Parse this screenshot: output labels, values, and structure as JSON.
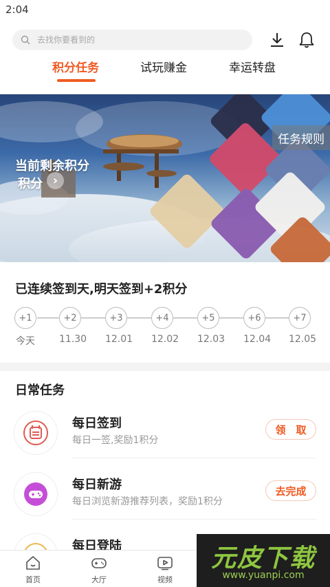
{
  "status_bar": {
    "time": "2:04"
  },
  "search": {
    "placeholder": "去找你要看到的"
  },
  "tabs": [
    {
      "label": "积分任务",
      "active": true
    },
    {
      "label": "试玩赚金",
      "active": false
    },
    {
      "label": "幸运转盘",
      "active": false
    }
  ],
  "banner": {
    "points_title": "当前剩余积分",
    "points_value": "积分",
    "rules_button": "任务规则"
  },
  "signin": {
    "title": "已连续签到天,明天签到+2积分",
    "steps": [
      {
        "reward": "+1",
        "date": "今天"
      },
      {
        "reward": "+2",
        "date": "11.30"
      },
      {
        "reward": "+3",
        "date": "12.01"
      },
      {
        "reward": "+4",
        "date": "12.02"
      },
      {
        "reward": "+5",
        "date": "12.03"
      },
      {
        "reward": "+6",
        "date": "12.04"
      },
      {
        "reward": "+7",
        "date": "12.05"
      }
    ]
  },
  "daily": {
    "title": "日常任务",
    "tasks": [
      {
        "name": "每日签到",
        "desc": "每日一签,奖励1积分",
        "button": "领　取",
        "icon": "calendar-icon",
        "color": "#e05a52"
      },
      {
        "name": "每日新游",
        "desc": "每日浏览新游推荐列表，奖励1积分",
        "button": "去完成",
        "icon": "gamepad-icon",
        "color": "#c44fd6"
      },
      {
        "name": "每日登陆",
        "desc": "",
        "button": "",
        "icon": "login-icon",
        "color": "#e8b84a"
      }
    ]
  },
  "bottom_nav": [
    {
      "label": "首页",
      "icon": "home-icon"
    },
    {
      "label": "大厅",
      "icon": "gamepad-icon"
    },
    {
      "label": "视频",
      "icon": "video-icon"
    }
  ],
  "watermark": {
    "title": "元皮下载",
    "url": "www.yuanpi.com"
  },
  "colors": {
    "accent": "#f05a22",
    "muted": "#999999"
  }
}
